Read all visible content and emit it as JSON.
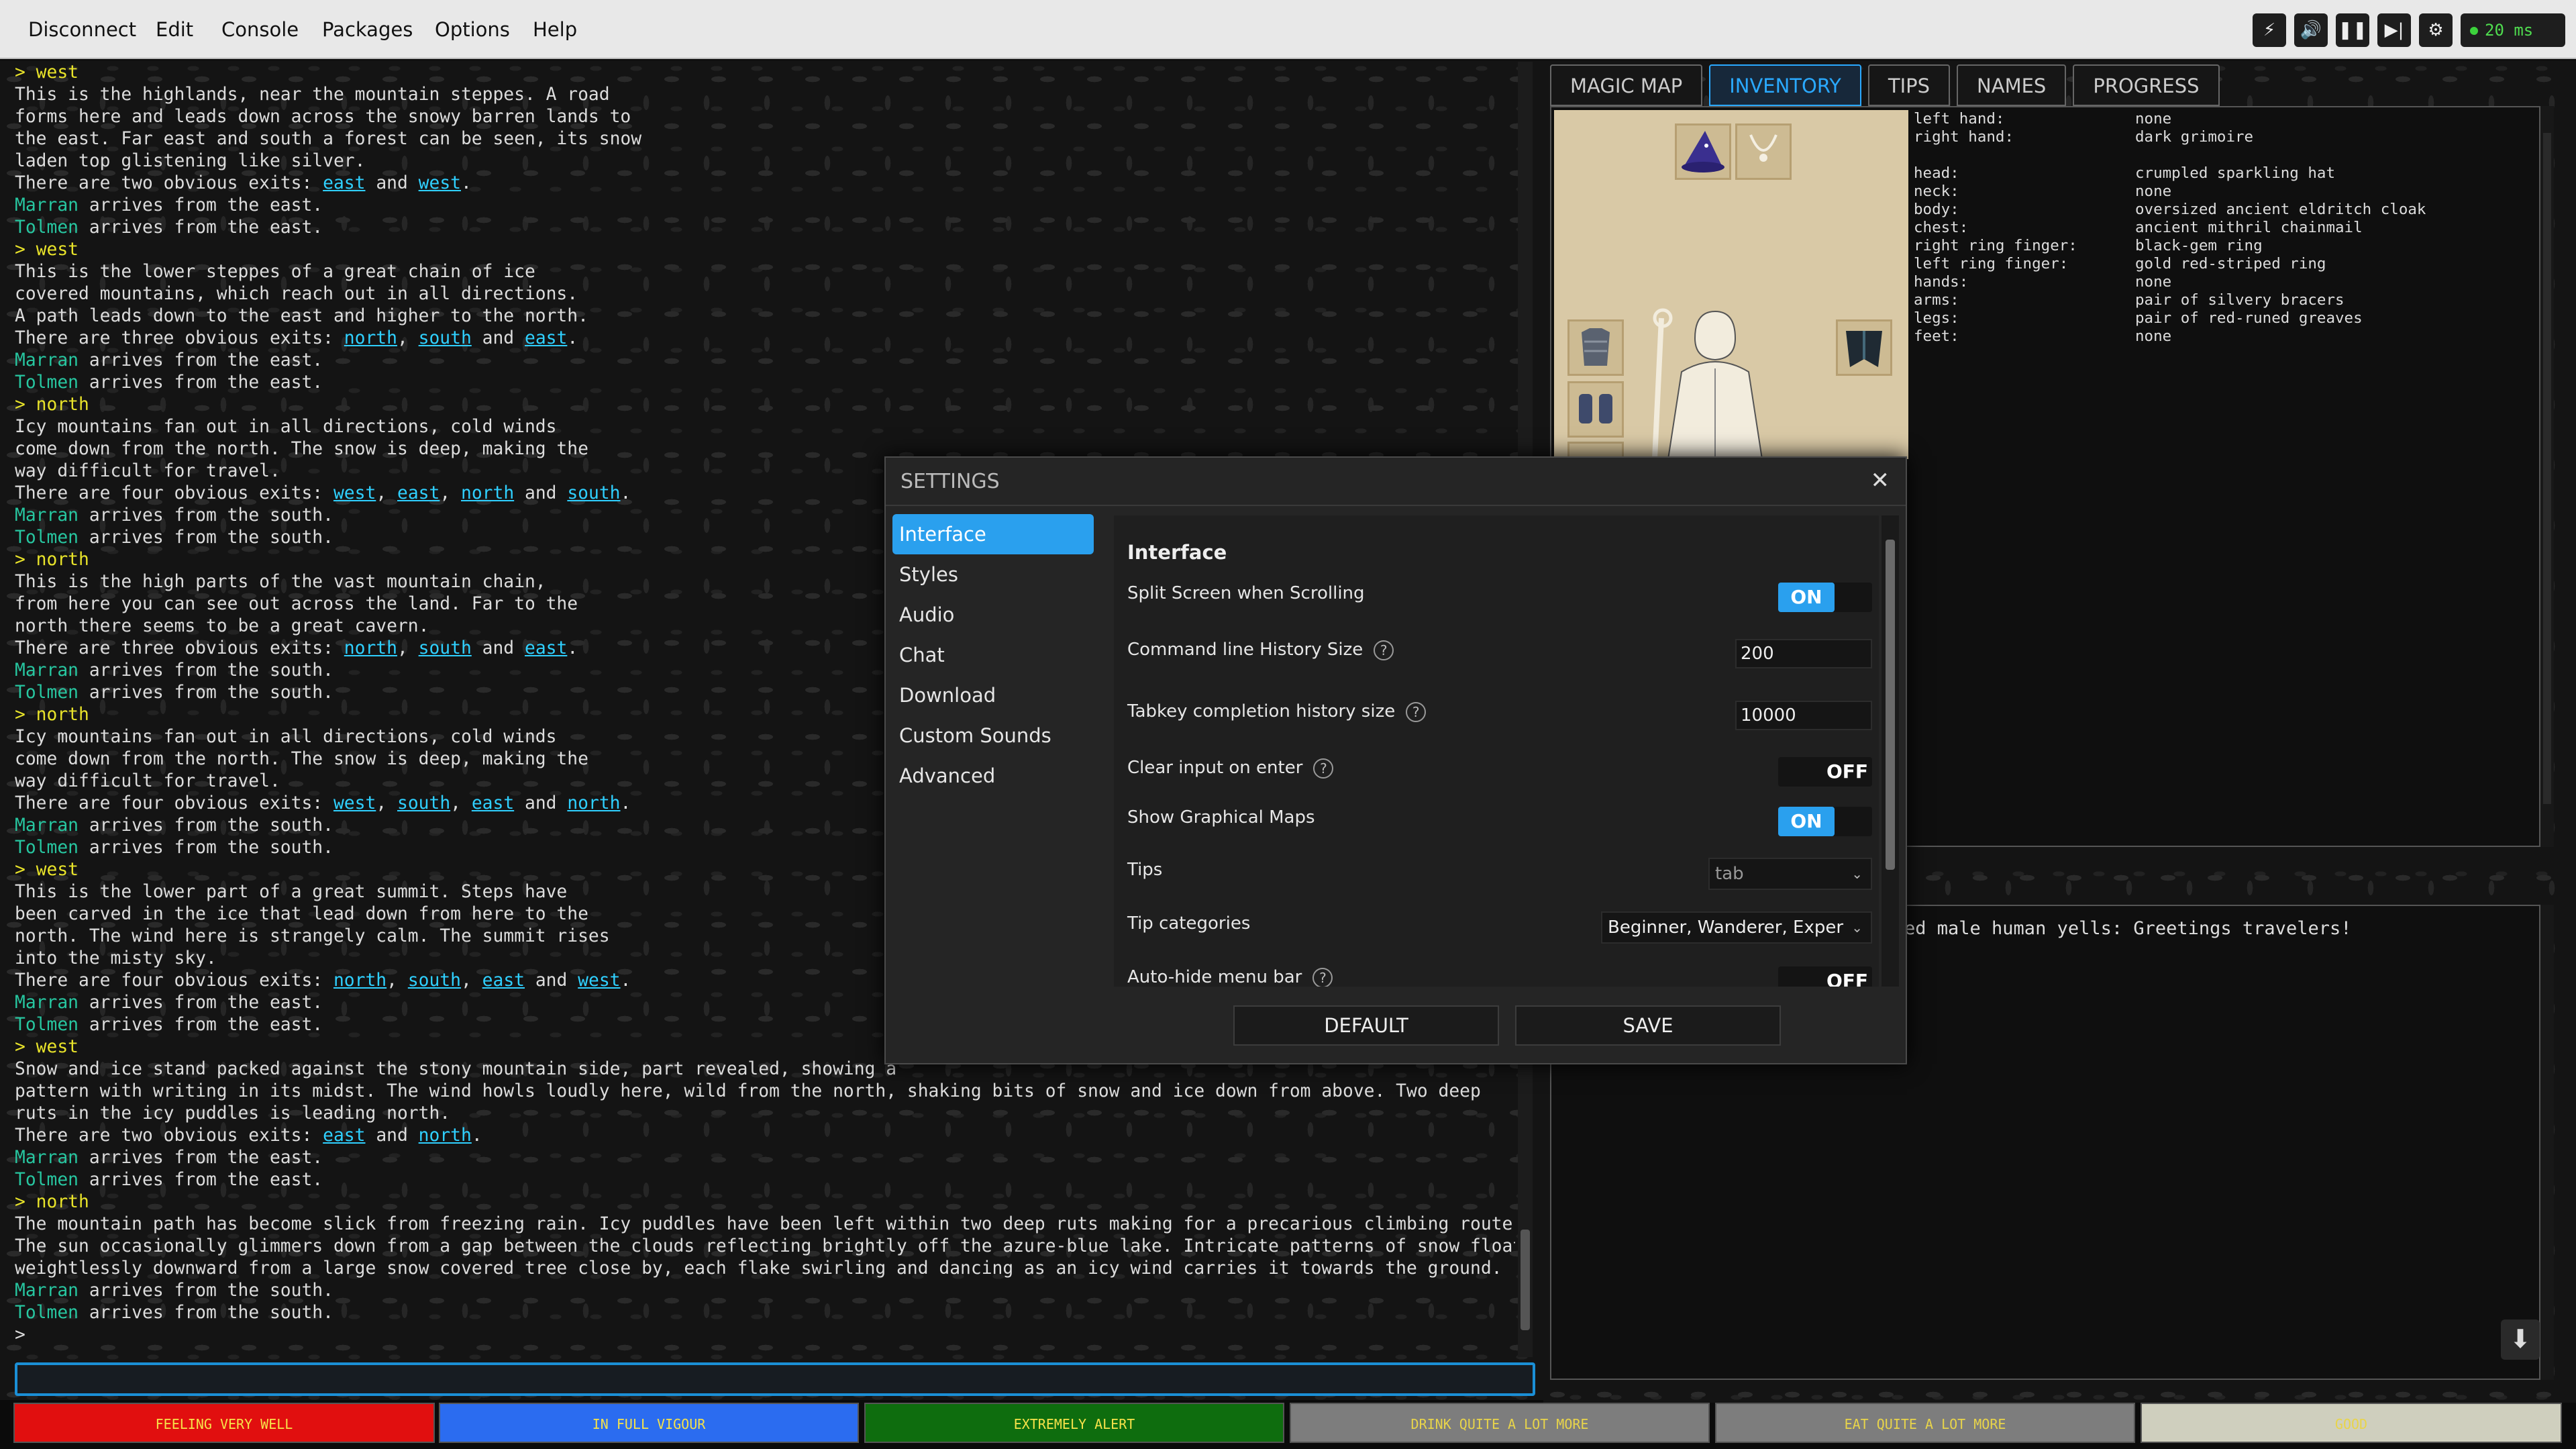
{
  "menu": {
    "items": [
      "Disconnect",
      "Edit",
      "Console",
      "Packages",
      "Options",
      "Help"
    ]
  },
  "toolbar": {
    "ping": "20 ms",
    "icons": [
      "lightning-icon",
      "speaker-icon",
      "pause-icon",
      "skip-icon",
      "gear-icon"
    ]
  },
  "output": {
    "lines": [
      [
        [
          "cmd",
          "> west"
        ]
      ],
      [
        [
          "t",
          "This is the highlands, near the mountain steppes. A road"
        ]
      ],
      [
        [
          "t",
          "forms here and leads down across the snowy barren lands to"
        ]
      ],
      [
        [
          "t",
          "the east. Far east and south a forest can be seen, its snow"
        ]
      ],
      [
        [
          "t",
          "laden top glistening like silver."
        ]
      ],
      [
        [
          "t",
          "There are two obvious exits: "
        ],
        [
          "ex",
          "east"
        ],
        [
          "t",
          " and "
        ],
        [
          "ex",
          "west"
        ],
        [
          "t",
          "."
        ]
      ],
      [
        [
          "nm",
          "Marran"
        ],
        [
          "t",
          " arrives from the east."
        ]
      ],
      [
        [
          "nm",
          "Tolmen"
        ],
        [
          "t",
          " arrives from the east."
        ]
      ],
      [
        [
          "cmd",
          "> west"
        ]
      ],
      [
        [
          "t",
          "This is the lower steppes of a great chain of ice"
        ]
      ],
      [
        [
          "t",
          "covered mountains, which reach out in all directions."
        ]
      ],
      [
        [
          "t",
          "A path leads down to the east and higher to the north."
        ]
      ],
      [
        [
          "t",
          "There are three obvious exits: "
        ],
        [
          "ex",
          "north"
        ],
        [
          "t",
          ", "
        ],
        [
          "ex",
          "south"
        ],
        [
          "t",
          " and "
        ],
        [
          "ex",
          "east"
        ],
        [
          "t",
          "."
        ]
      ],
      [
        [
          "nm",
          "Marran"
        ],
        [
          "t",
          " arrives from the east."
        ]
      ],
      [
        [
          "nm",
          "Tolmen"
        ],
        [
          "t",
          " arrives from the east."
        ]
      ],
      [
        [
          "cmd",
          "> north"
        ]
      ],
      [
        [
          "t",
          "Icy mountains fan out in all directions, cold winds"
        ]
      ],
      [
        [
          "t",
          "come down from the north. The snow is deep, making the"
        ]
      ],
      [
        [
          "t",
          "way difficult for travel."
        ]
      ],
      [
        [
          "t",
          "There are four obvious exits: "
        ],
        [
          "ex",
          "west"
        ],
        [
          "t",
          ", "
        ],
        [
          "ex",
          "east"
        ],
        [
          "t",
          ", "
        ],
        [
          "ex",
          "north"
        ],
        [
          "t",
          " and "
        ],
        [
          "ex",
          "south"
        ],
        [
          "t",
          "."
        ]
      ],
      [
        [
          "nm",
          "Marran"
        ],
        [
          "t",
          " arrives from the south."
        ]
      ],
      [
        [
          "nm",
          "Tolmen"
        ],
        [
          "t",
          " arrives from the south."
        ]
      ],
      [
        [
          "cmd",
          "> north"
        ]
      ],
      [
        [
          "t",
          "This is the high parts of the vast mountain chain,"
        ]
      ],
      [
        [
          "t",
          "from here you can see out across the land. Far to the"
        ]
      ],
      [
        [
          "t",
          "north there seems to be a great cavern."
        ]
      ],
      [
        [
          "t",
          "There are three obvious exits: "
        ],
        [
          "ex",
          "north"
        ],
        [
          "t",
          ", "
        ],
        [
          "ex",
          "south"
        ],
        [
          "t",
          " and "
        ],
        [
          "ex",
          "east"
        ],
        [
          "t",
          "."
        ]
      ],
      [
        [
          "nm",
          "Marran"
        ],
        [
          "t",
          " arrives from the south."
        ]
      ],
      [
        [
          "nm",
          "Tolmen"
        ],
        [
          "t",
          " arrives from the south."
        ]
      ],
      [
        [
          "cmd",
          "> north"
        ]
      ],
      [
        [
          "t",
          "Icy mountains fan out in all directions, cold winds"
        ]
      ],
      [
        [
          "t",
          "come down from the north. The snow is deep, making the"
        ]
      ],
      [
        [
          "t",
          "way difficult for travel."
        ]
      ],
      [
        [
          "t",
          "There are four obvious exits: "
        ],
        [
          "ex",
          "west"
        ],
        [
          "t",
          ", "
        ],
        [
          "ex",
          "south"
        ],
        [
          "t",
          ", "
        ],
        [
          "ex",
          "east"
        ],
        [
          "t",
          " and "
        ],
        [
          "ex",
          "north"
        ],
        [
          "t",
          "."
        ]
      ],
      [
        [
          "nm",
          "Marran"
        ],
        [
          "t",
          " arrives from the south."
        ]
      ],
      [
        [
          "nm",
          "Tolmen"
        ],
        [
          "t",
          " arrives from the south."
        ]
      ],
      [
        [
          "cmd",
          "> west"
        ]
      ],
      [
        [
          "t",
          "This is the lower part of a great summit. Steps have"
        ]
      ],
      [
        [
          "t",
          "been carved in the ice that lead down from here to the"
        ]
      ],
      [
        [
          "t",
          "north. The wind here is strangely calm. The summit rises"
        ]
      ],
      [
        [
          "t",
          "into the misty sky."
        ]
      ],
      [
        [
          "t",
          "There are four obvious exits: "
        ],
        [
          "ex",
          "north"
        ],
        [
          "t",
          ", "
        ],
        [
          "ex",
          "south"
        ],
        [
          "t",
          ", "
        ],
        [
          "ex",
          "east"
        ],
        [
          "t",
          " and "
        ],
        [
          "ex",
          "west"
        ],
        [
          "t",
          "."
        ]
      ],
      [
        [
          "nm",
          "Marran"
        ],
        [
          "t",
          " arrives from the east."
        ]
      ],
      [
        [
          "nm",
          "Tolmen"
        ],
        [
          "t",
          " arrives from the east."
        ]
      ],
      [
        [
          "cmd",
          "> west"
        ]
      ],
      [
        [
          "t",
          "Snow and ice stand packed against the stony mountain side, part revealed, showing a"
        ]
      ],
      [
        [
          "t",
          "pattern with writing in its midst. The wind howls loudly here, wild from the north, shaking bits of snow and ice down from above. Two deep"
        ]
      ],
      [
        [
          "t",
          "ruts in the icy puddles is leading north."
        ]
      ],
      [
        [
          "t",
          "There are two obvious exits: "
        ],
        [
          "ex",
          "east"
        ],
        [
          "t",
          " and "
        ],
        [
          "ex",
          "north"
        ],
        [
          "t",
          "."
        ]
      ],
      [
        [
          "nm",
          "Marran"
        ],
        [
          "t",
          " arrives from the east."
        ]
      ],
      [
        [
          "nm",
          "Tolmen"
        ],
        [
          "t",
          " arrives from the east."
        ]
      ],
      [
        [
          "cmd",
          "> north"
        ]
      ],
      [
        [
          "t",
          "The mountain path has become slick from freezing rain. Icy puddles have been left within two deep ruts making for a precarious climbing route."
        ]
      ],
      [
        [
          "t",
          "The sun occasionally glimmers down from a gap between the clouds reflecting brightly off the azure-blue lake. Intricate patterns of snow float"
        ]
      ],
      [
        [
          "t",
          "weightlessly downward from a large snow covered tree close by, each flake swirling and dancing as an icy wind carries it towards the ground."
        ]
      ],
      [
        [
          "nm",
          "Marran"
        ],
        [
          "t",
          " arrives from the south."
        ]
      ],
      [
        [
          "nm",
          "Tolmen"
        ],
        [
          "t",
          " arrives from the south."
        ]
      ],
      [
        [
          "t",
          "> "
        ]
      ]
    ]
  },
  "status_bars": [
    {
      "label": "FEELING VERY WELL",
      "bg": "#e10f0f",
      "fg": "#f6e24a"
    },
    {
      "label": "IN FULL VIGOUR",
      "bg": "#2b6cf0",
      "fg": "#f6e24a"
    },
    {
      "label": "EXTREMELY ALERT",
      "bg": "#0e6d0e",
      "fg": "#f6e24a"
    },
    {
      "label": "DRINK QUITE A LOT MORE",
      "bg": "#7d7d7d",
      "fg": "#e8d44a"
    },
    {
      "label": "EAT QUITE A LOT MORE",
      "bg": "#7d7d7d",
      "fg": "#e8d44a"
    },
    {
      "label": "GOOD",
      "bg": "#cfcfbe",
      "fg": "#e8d44a"
    }
  ],
  "tabs": [
    {
      "label": "MAGIC MAP",
      "active": false
    },
    {
      "label": "INVENTORY",
      "active": true
    },
    {
      "label": "TIPS",
      "active": false
    },
    {
      "label": "NAMES",
      "active": false
    },
    {
      "label": "PROGRESS",
      "active": false
    }
  ],
  "equipment": [
    [
      "left hand:",
      "none"
    ],
    [
      "right hand:",
      "dark grimoire"
    ],
    [
      "",
      ""
    ],
    [
      "head:",
      "crumpled sparkling hat"
    ],
    [
      "neck:",
      "none"
    ],
    [
      "body:",
      "oversized ancient eldritch cloak"
    ],
    [
      "chest:",
      "ancient mithril chainmail"
    ],
    [
      "right ring finger:",
      "black-gem ring"
    ],
    [
      "left ring finger:",
      "gold red-striped ring"
    ],
    [
      "hands:",
      "none"
    ],
    [
      "arms:",
      "pair of silvery bracers"
    ],
    [
      "legs:",
      "pair of red-runed greaves"
    ],
    [
      "feet:",
      "none"
    ]
  ],
  "chat": {
    "line": "ed male human yells: Greetings travelers!"
  },
  "settings": {
    "title": "SETTINGS",
    "categories": [
      "Interface",
      "Styles",
      "Audio",
      "Chat",
      "Download",
      "Custom Sounds",
      "Advanced"
    ],
    "selected": "Interface",
    "section_title": "Interface",
    "rows": [
      {
        "label": "Split Screen when Scrolling",
        "type": "toggle",
        "value": "ON",
        "help": false
      },
      {
        "label": "Command line History Size",
        "type": "text",
        "value": "200",
        "help": true
      },
      {
        "label": "Tabkey completion history size",
        "type": "text",
        "value": "10000",
        "help": true
      },
      {
        "label": "Clear input on enter",
        "type": "toggle",
        "value": "OFF",
        "help": true
      },
      {
        "label": "Show Graphical Maps",
        "type": "toggle",
        "value": "ON",
        "help": false
      },
      {
        "label": "Tips",
        "type": "select",
        "value": "tab",
        "help": false
      },
      {
        "label": "Tip categories",
        "type": "select",
        "value": "Beginner, Wanderer, Exper",
        "help": false
      },
      {
        "label": "Auto-hide menu bar",
        "type": "toggle",
        "value": "OFF",
        "help": true
      }
    ],
    "default_label": "DEFAULT",
    "save_label": "SAVE"
  }
}
